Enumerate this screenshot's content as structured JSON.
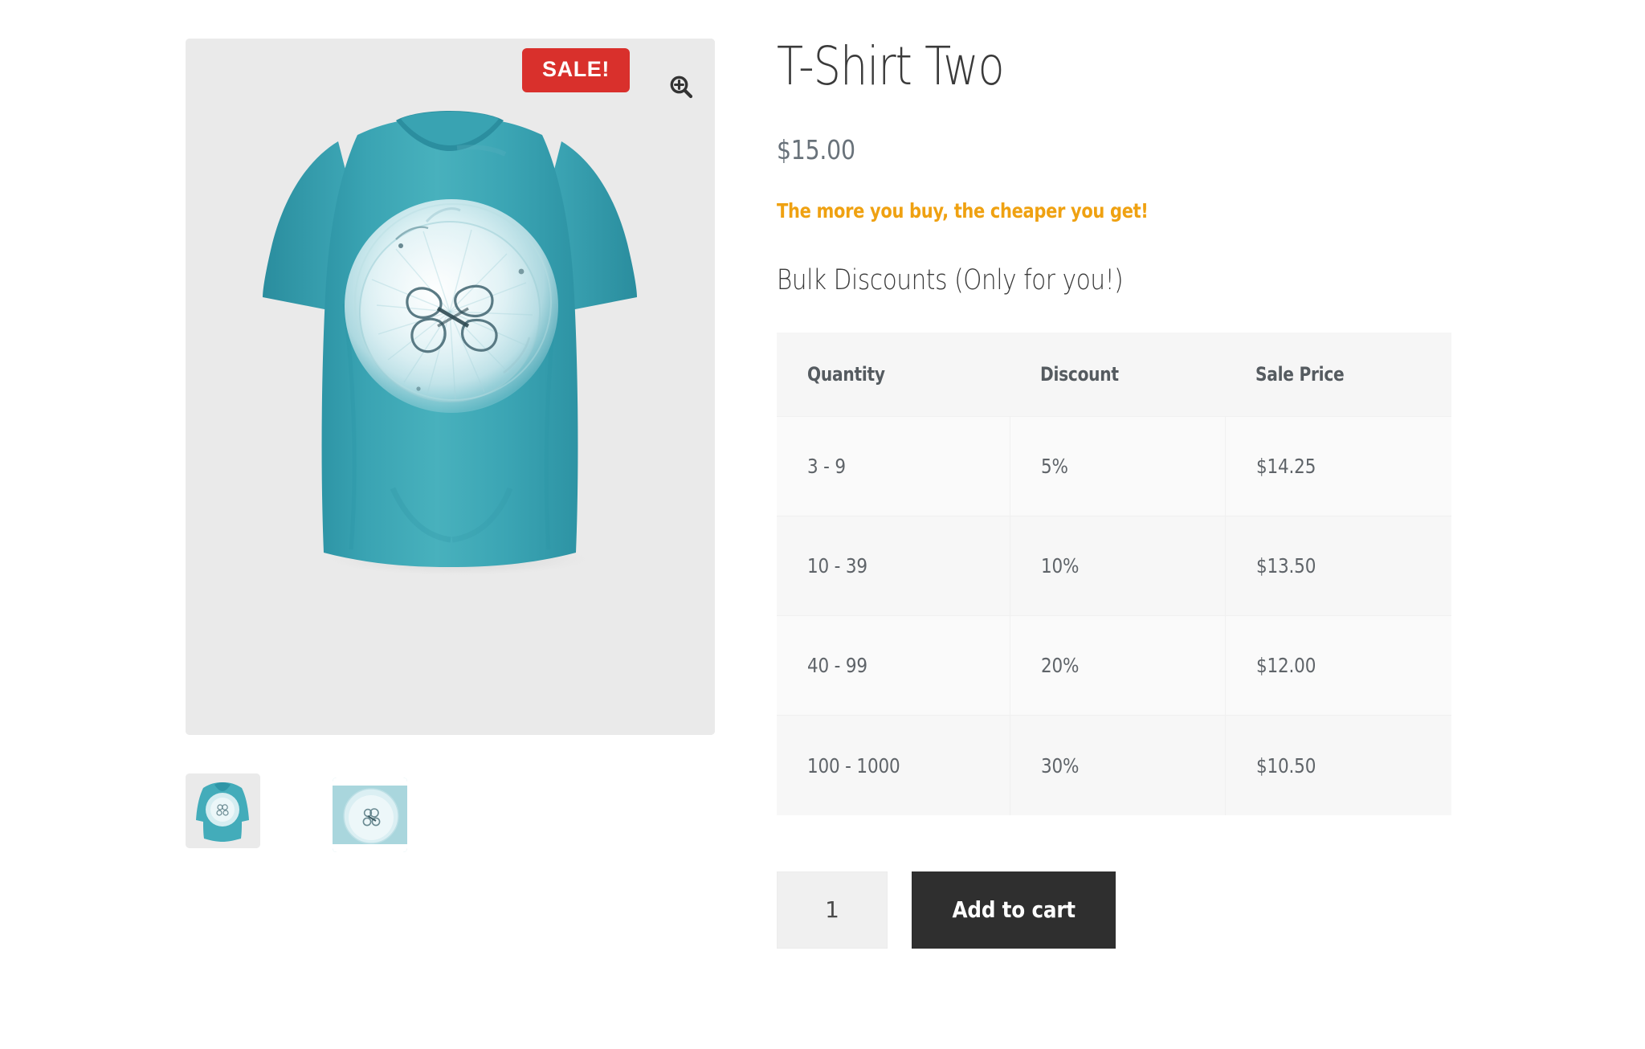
{
  "product": {
    "title": "T-Shirt Two",
    "price": "$15.00",
    "promo_text": "The more you buy, the cheaper you get!",
    "sale_badge": "SALE!",
    "zoom_icon": "magnifier-plus-icon"
  },
  "gallery": {
    "main_image_alt": "teal t-shirt with jellyfish circle print",
    "thumbnails": [
      {
        "alt": "teal t-shirt front view"
      },
      {
        "alt": "close-up of jellyfish print"
      }
    ]
  },
  "bulk": {
    "heading": "Bulk Discounts (Only for you!)",
    "columns": [
      "Quantity",
      "Discount",
      "Sale Price"
    ],
    "rows": [
      {
        "quantity": "3 - 9",
        "discount": "5%",
        "sale_price": "$14.25"
      },
      {
        "quantity": "10 - 39",
        "discount": "10%",
        "sale_price": "$13.50"
      },
      {
        "quantity": "40 - 99",
        "discount": "20%",
        "sale_price": "$12.00"
      },
      {
        "quantity": "100 - 1000",
        "discount": "30%",
        "sale_price": "$10.50"
      }
    ]
  },
  "cart": {
    "quantity_value": "1",
    "quantity_placeholder": "1",
    "add_to_cart_label": "Add to cart"
  },
  "colors": {
    "sale_badge_bg": "#d9302c",
    "promo_text": "#efa111",
    "add_to_cart_bg": "#2f2f2f",
    "shirt_teal": "#3a9fae",
    "image_bg": "#eaeaea",
    "table_header_bg": "#f6f6f6",
    "table_row_bg": "#fafafa"
  }
}
